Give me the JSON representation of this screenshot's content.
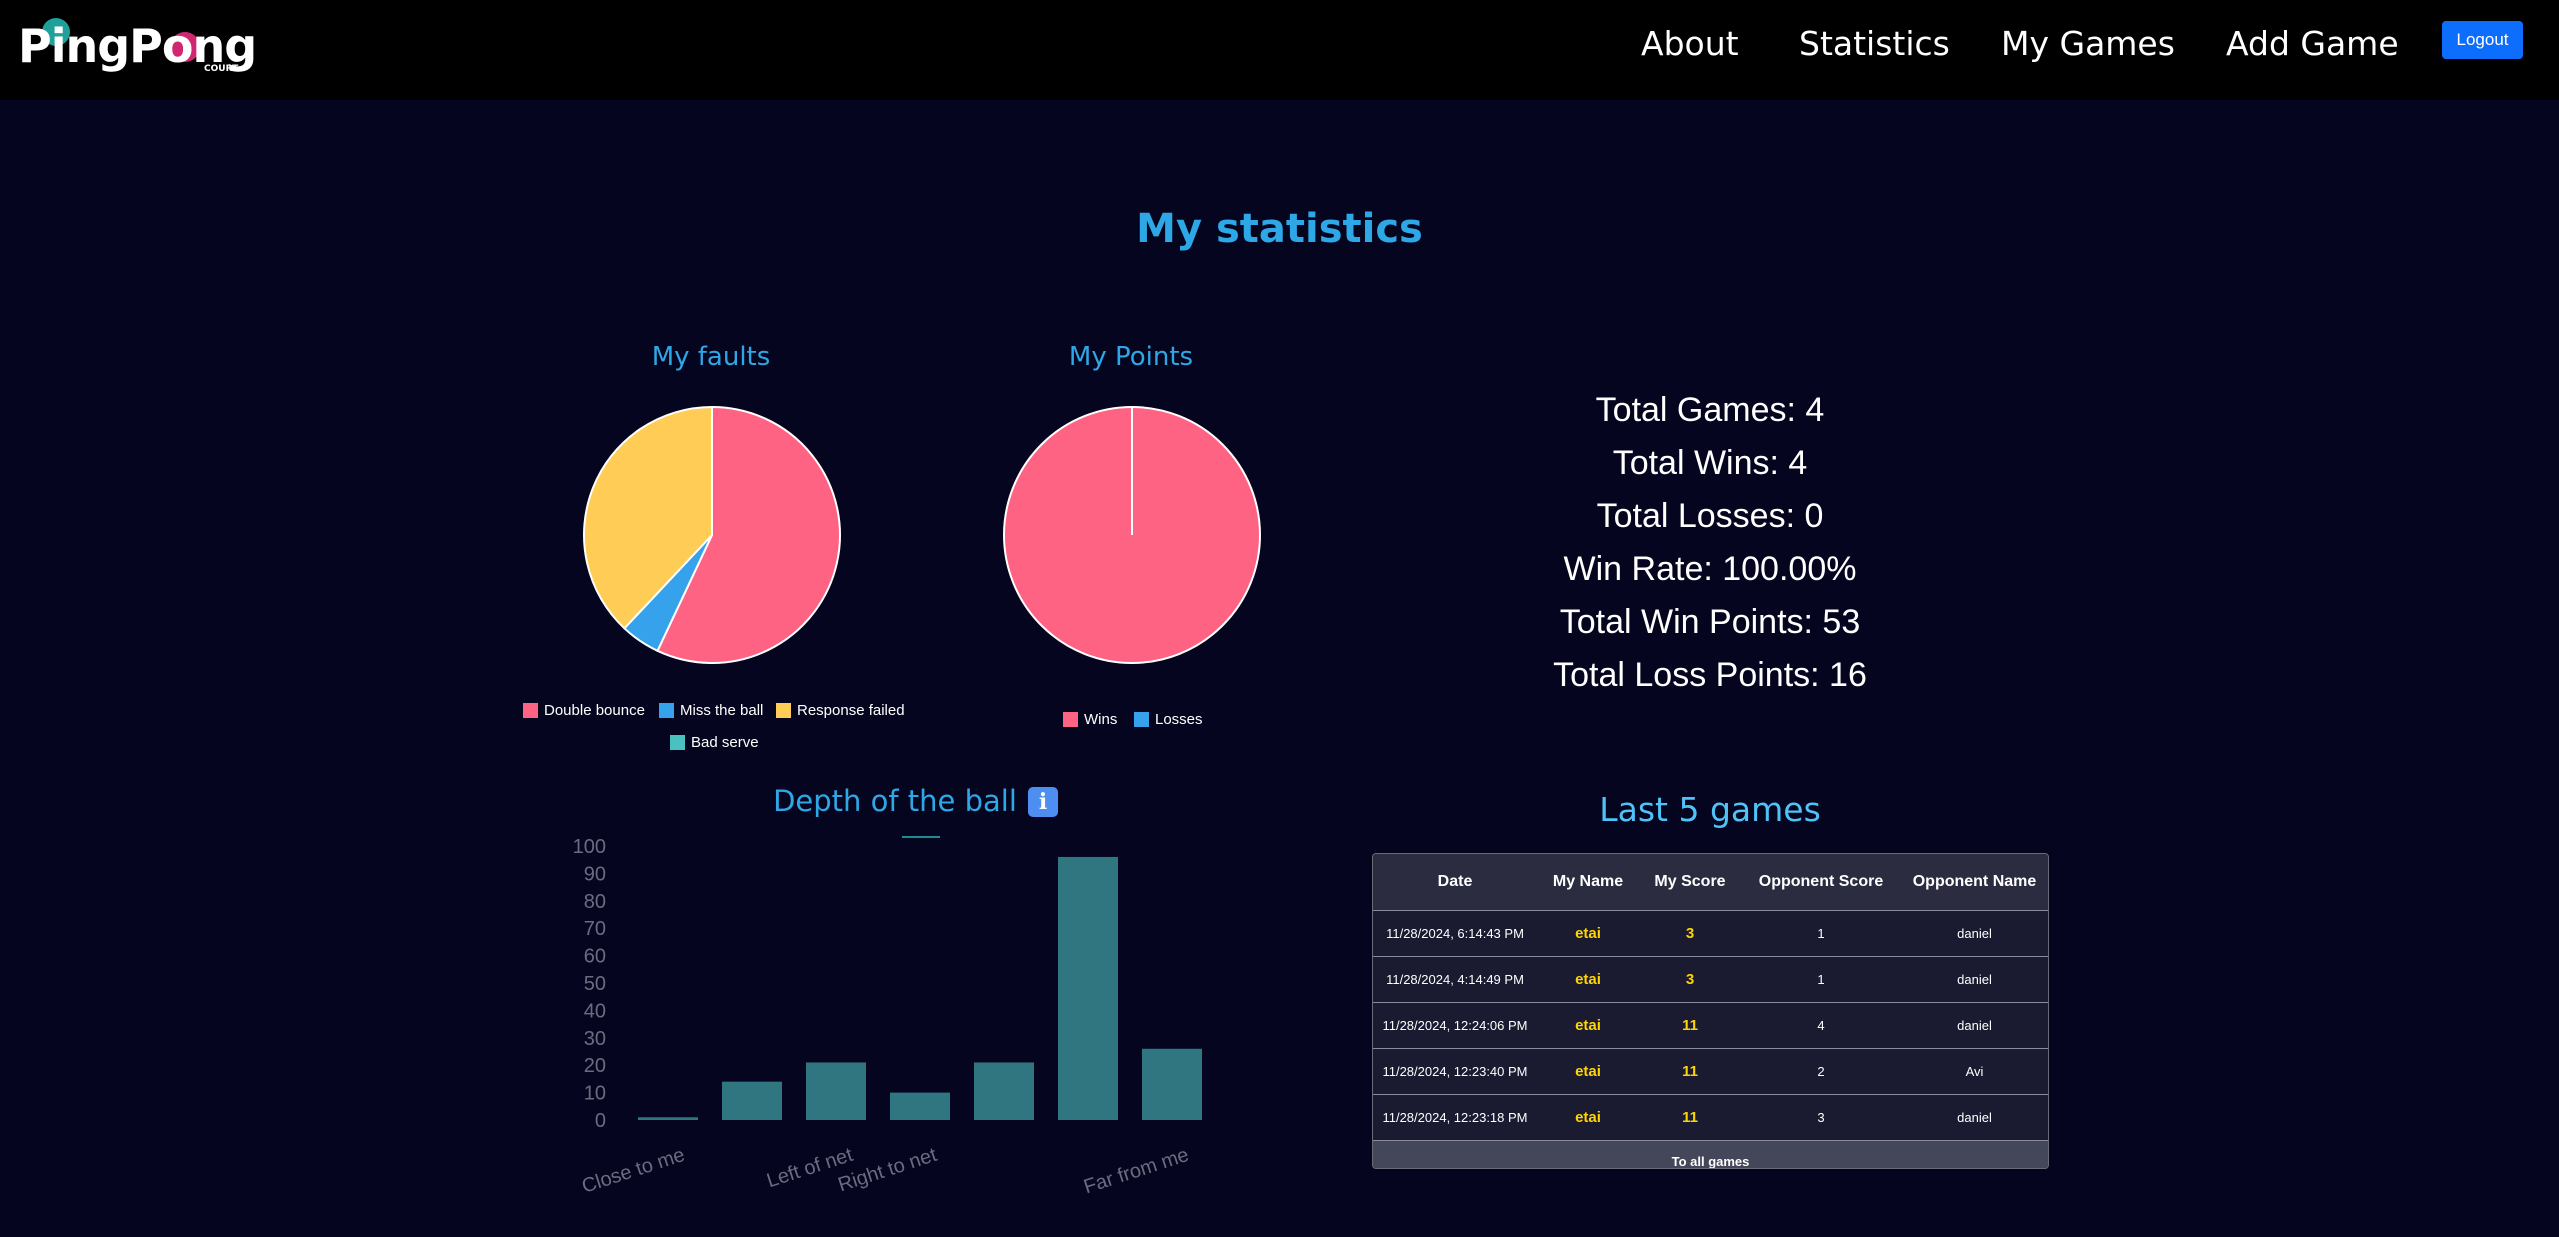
{
  "nav": {
    "logo_text": "PingPong",
    "logo_sub": "COURT",
    "links": [
      "About",
      "Statistics",
      "My Games",
      "Add Game"
    ],
    "logout": "Logout"
  },
  "page_title": "My statistics",
  "faults": {
    "title": "My faults",
    "legend": [
      "Double bounce",
      "Miss the ball",
      "Response failed",
      "Bad serve"
    ]
  },
  "points": {
    "title": "My Points",
    "legend": [
      "Wins",
      "Losses"
    ]
  },
  "stats": [
    "Total Games: 4",
    "Total Wins: 4",
    "Total Losses: 0",
    "Win Rate: 100.00%",
    "Total Win Points: 53",
    "Total Loss Points: 16"
  ],
  "depth": {
    "title": "Depth of the ball",
    "info_icon": "info-icon"
  },
  "last_games": {
    "title": "Last 5 games",
    "headers": [
      "Date",
      "My Name",
      "My Score",
      "Opponent Score",
      "Opponent Name"
    ],
    "rows": [
      [
        "11/28/2024, 6:14:43 PM",
        "etai",
        "3",
        "1",
        "daniel"
      ],
      [
        "11/28/2024, 4:14:49 PM",
        "etai",
        "3",
        "1",
        "daniel"
      ],
      [
        "11/28/2024, 12:24:06 PM",
        "etai",
        "11",
        "4",
        "daniel"
      ],
      [
        "11/28/2024, 12:23:40 PM",
        "etai",
        "11",
        "2",
        "Avi"
      ],
      [
        "11/28/2024, 12:23:18 PM",
        "etai",
        "11",
        "3",
        "daniel"
      ]
    ],
    "footer": "To all games"
  },
  "colors": {
    "double_bounce": "#ff6384",
    "miss_ball": "#36a2eb",
    "response_failed": "#ffcd56",
    "bad_serve": "#4bc0c0",
    "bar": "#2f7680",
    "accent": "#2ea7e6"
  },
  "chart_data": [
    {
      "type": "pie",
      "title": "My faults",
      "labels": [
        "Double bounce",
        "Miss the ball",
        "Response failed",
        "Bad serve"
      ],
      "values": [
        57,
        5,
        38,
        0
      ]
    },
    {
      "type": "pie",
      "title": "My Points",
      "labels": [
        "Wins",
        "Losses"
      ],
      "values": [
        53,
        0
      ]
    },
    {
      "type": "bar",
      "title": "Depth of the ball",
      "categories": [
        "Close to me",
        "",
        "Left of net",
        "Right to net",
        "",
        "",
        "Far from me"
      ],
      "values": [
        1,
        14,
        21,
        10,
        21,
        96,
        26
      ],
      "ylim": [
        0,
        100
      ],
      "yticks": [
        0,
        10,
        20,
        30,
        40,
        50,
        60,
        70,
        80,
        90,
        100
      ]
    }
  ]
}
